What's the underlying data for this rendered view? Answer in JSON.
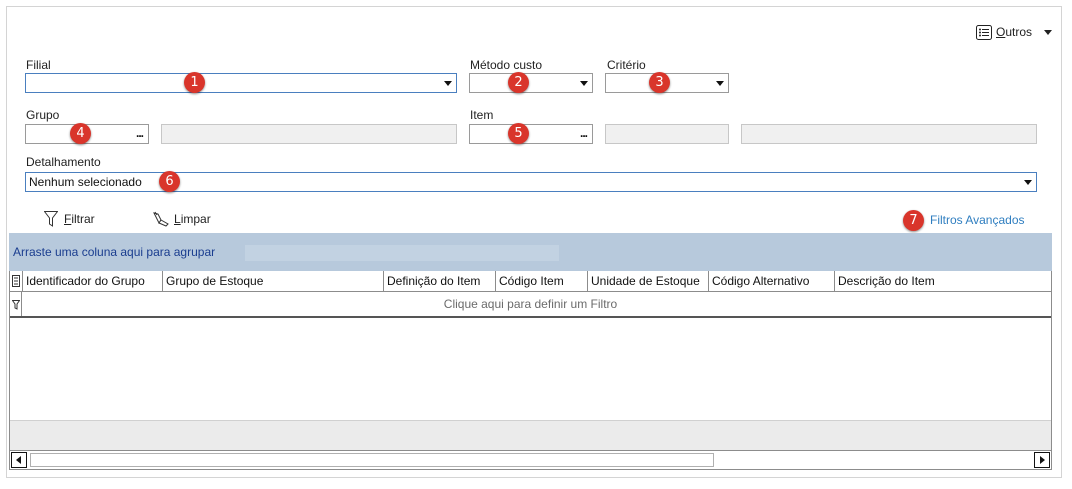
{
  "toolbar": {
    "outros_label": "Outros",
    "outros_mnemonic": "O",
    "outros_rest": "utros"
  },
  "filters": {
    "filial": {
      "label": "Filial",
      "value": "",
      "badge": "1"
    },
    "metodo": {
      "label": "Método custo",
      "value": "",
      "badge": "2"
    },
    "criterio": {
      "label": "Critério",
      "value": "",
      "badge": "3"
    },
    "grupo": {
      "label": "Grupo",
      "value": "",
      "badge": "4",
      "lookup": "..."
    },
    "item": {
      "label": "Item",
      "value": "",
      "badge": "5",
      "lookup": "..."
    },
    "detalhamento": {
      "label": "Detalhamento",
      "value": "Nenhum selecionado",
      "badge": "6"
    }
  },
  "actions": {
    "filtrar": {
      "mnemonic": "F",
      "rest": "iltrar"
    },
    "limpar": {
      "mnemonic": "L",
      "rest": "impar"
    },
    "avancados": {
      "label": "Filtros Avançados",
      "badge": "7"
    }
  },
  "grid": {
    "group_hint": "Arraste uma coluna aqui para agrupar",
    "columns": [
      "Identificador do Grupo",
      "Grupo de Estoque",
      "Definição do Item",
      "Código Item",
      "Unidade de Estoque",
      "Código Alternativo",
      "Descrição do Item"
    ],
    "filter_hint": "Clique aqui para definir um Filtro"
  },
  "colors": {
    "badge": "#d9352b",
    "link": "#2f7ec0",
    "group_band": "#b7c9dc",
    "group_text": "#1a3d8f"
  }
}
